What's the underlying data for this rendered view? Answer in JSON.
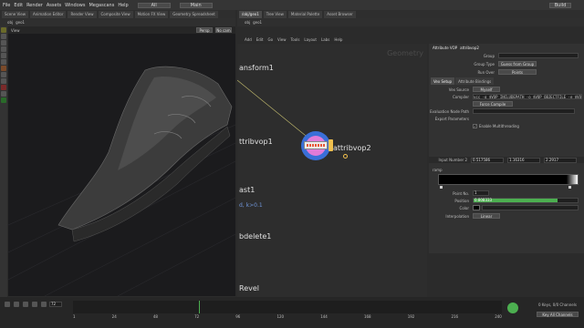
{
  "menubar": {
    "items": [
      "File",
      "Edit",
      "Render",
      "Assets",
      "Windows",
      "Megascans",
      "Help"
    ],
    "desktop": "All",
    "obj_context": "Main",
    "build": "Build"
  },
  "left_tabs": [
    "Scene View",
    "Animation Editor",
    "Render View",
    "Composite View",
    "Motion FX View",
    "Geometry Spreadsheet"
  ],
  "viewport": {
    "label": "View",
    "path": [
      "obj",
      "geo1"
    ],
    "camera_menu": "Persp",
    "cam_menu": "No cam"
  },
  "right_tabs": [
    "/obj/geo1",
    "Tree View",
    "Material Palette",
    "Asset Browser"
  ],
  "network": {
    "menu": [
      "Add",
      "Edit",
      "Go",
      "View",
      "Tools",
      "Layout",
      "Labs",
      "Help"
    ],
    "path": [
      "obj",
      "geo1"
    ],
    "context_label": "Geometry",
    "nodes": {
      "n1": "ansform1",
      "n2": "ttribvop1",
      "n3": "ast1",
      "n3_param": "d, k>0.1",
      "n4": "bdelete1",
      "n5": "Revel",
      "selected": "attribvop2"
    }
  },
  "params": {
    "node_type": "Attribute VOP",
    "node_name": "attribvop2",
    "group_label": "Group",
    "group_type_label": "Group Type",
    "group_type_value": "Guess from Group",
    "run_over_label": "Run Over",
    "run_over_value": "Points",
    "tabs": [
      "Vex Setup",
      "Attribute Bindings"
    ],
    "vex_source_label": "Vex Source",
    "vex_source_value": "Myself",
    "compiler_label": "Compiler",
    "compiler_value": "vcc -q $VOP_INCLUDEPATH -o $VOP_OBJECTFILE -e $VOP",
    "force_compile": "Force Compile",
    "eval_node_path_label": "Evaluation Node Path",
    "export_params_label": "Export Parameters",
    "multithreading_label": "Enable Multithreading",
    "multithreading_checked": true,
    "input_number_label": "Input Number 2",
    "input_values": [
      "0.517586",
      "1.16316",
      "2.2917"
    ],
    "ramp_label": "ramp",
    "point_no_label": "Point No.",
    "point_no_value": "1",
    "position_label": "Position",
    "position_value": "0.808333",
    "position_fraction": 0.808,
    "color_label": "Color",
    "interpolation_label": "Interpolation",
    "interpolation_value": "Linear"
  },
  "timeline": {
    "current_frame": "72",
    "ticks": [
      "1",
      "24",
      "48",
      "72",
      "96",
      "120",
      "144",
      "168",
      "192",
      "216",
      "240"
    ],
    "end_fields": [
      "1",
      "1",
      "240",
      "240"
    ],
    "keys_label": "0 Keys, 0/0 Channels",
    "channels_label": "Key All Channels"
  },
  "colors": {
    "node_ring": "#3a6fd8",
    "node_inner": "#e07bd8",
    "position_bar": "#4caf50",
    "accent_blue": "#2f5fa8"
  }
}
